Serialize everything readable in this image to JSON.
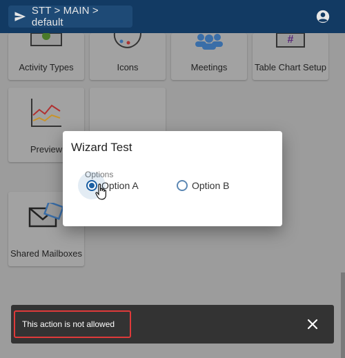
{
  "header": {
    "breadcrumb": "STT > MAIN > default",
    "send_icon": "send-icon",
    "account_icon": "account-circle-icon"
  },
  "tiles": [
    {
      "label": "Activity Types",
      "icon": "gear-tag-icon"
    },
    {
      "label": "Icons",
      "icon": "palette-icon"
    },
    {
      "label": "Meetings",
      "icon": "people-icon"
    },
    {
      "label": "Table Chart Setup",
      "icon": "hash-icon"
    },
    {
      "label": "Preview",
      "icon": "chart-lines-icon"
    },
    {
      "label": "Shared Mailboxes",
      "icon": "mail-icon"
    }
  ],
  "dialog": {
    "title": "Wizard Test",
    "group_label": "Options",
    "options": [
      {
        "label": "Option A",
        "selected": true
      },
      {
        "label": "Option B",
        "selected": false
      }
    ]
  },
  "snackbar": {
    "message": "This action is not allowed",
    "close_icon": "close-icon"
  },
  "colors": {
    "appbar": "#123a63",
    "accent": "#1b5fa3",
    "highlight": "#e03a3a"
  }
}
